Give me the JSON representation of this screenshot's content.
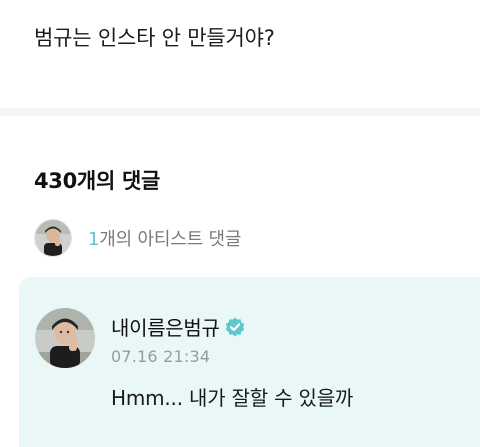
{
  "post": {
    "text": "범규는 인스타 안 만들거야?"
  },
  "comments": {
    "count_label": "430개의 댓글",
    "artist_filter": {
      "count": "1",
      "suffix": "개의 아티스트 댓글",
      "avatar_icon": "artist-avatar-icon"
    }
  },
  "artist_comment": {
    "author": "내이름은범규",
    "verified_icon": "verified-badge-icon",
    "timestamp": "07.16 21:34",
    "body": "Hmm... 내가 잘할 수 있을까"
  },
  "colors": {
    "accent": "#5ec8cf",
    "card_background": "#e9f8f7",
    "muted_text": "#7b7b7b"
  }
}
